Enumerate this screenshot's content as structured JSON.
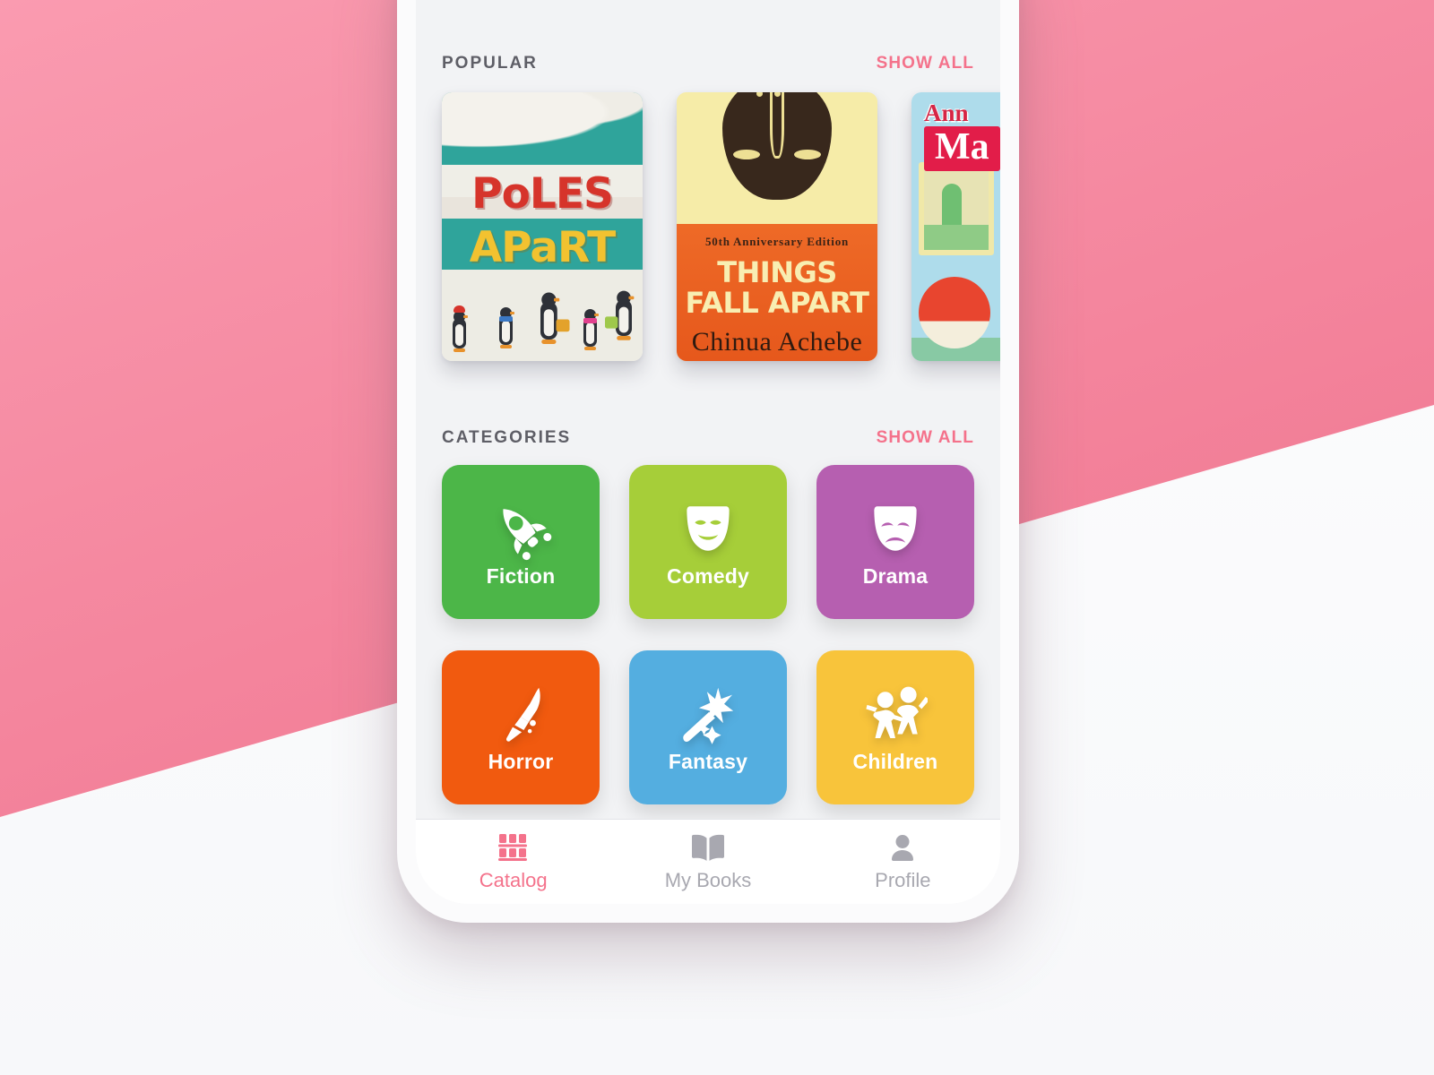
{
  "theme": {
    "background_pink": "#F27E97",
    "background_white": "#FAFAFB",
    "screen_background": "#F2F3F5",
    "accent_pink": "#F4728B",
    "header_text": "#5E5E66",
    "inactive_tab": "#A8A8B0"
  },
  "popular": {
    "title": "POPULAR",
    "show_all_label": "SHOW ALL",
    "books": [
      {
        "title_line1": "PoLES",
        "title_line2": "APaRT",
        "cover_style": "poles-apart",
        "accent_top": "#2FA49B",
        "accent_title": "#D6342B",
        "accent_subtitle": "#F2C230"
      },
      {
        "edition": "50th Anniversary Edition",
        "title_line1": "THINGS",
        "title_line2": "FALL APART",
        "author": "Chinua Achebe",
        "cover_style": "things-fall-apart",
        "accent_top": "#F6ECA8",
        "accent_bottom": "#EE6A27"
      },
      {
        "author_partial": "Ann",
        "title_partial": "Ma",
        "cover_style": "ann-m-partial",
        "accent_bg": "#AEDCEB",
        "accent_title": "#E21D49"
      }
    ]
  },
  "categories": {
    "title": "CATEGORIES",
    "show_all_label": "SHOW ALL",
    "items": [
      {
        "label": "Fiction",
        "color": "#4CB648",
        "icon": "rocket-icon"
      },
      {
        "label": "Comedy",
        "color": "#A6CE39",
        "icon": "comedy-mask-icon"
      },
      {
        "label": "Drama",
        "color": "#B濃",
        "icon": "drama-mask-icon"
      },
      {
        "label": "Horror",
        "color": "#F15A0F",
        "icon": "bloody-knife-icon"
      },
      {
        "label": "Fantasy",
        "color": "#54AEE0",
        "icon": "magic-wand-icon"
      },
      {
        "label": "Children",
        "color": "#F8C43B",
        "icon": "children-playing-icon"
      }
    ]
  },
  "tabbar": {
    "tabs": [
      {
        "label": "Catalog",
        "icon": "bookshelf-icon",
        "active": true
      },
      {
        "label": "My Books",
        "icon": "open-book-icon",
        "active": false
      },
      {
        "label": "Profile",
        "icon": "person-icon",
        "active": false
      }
    ]
  }
}
